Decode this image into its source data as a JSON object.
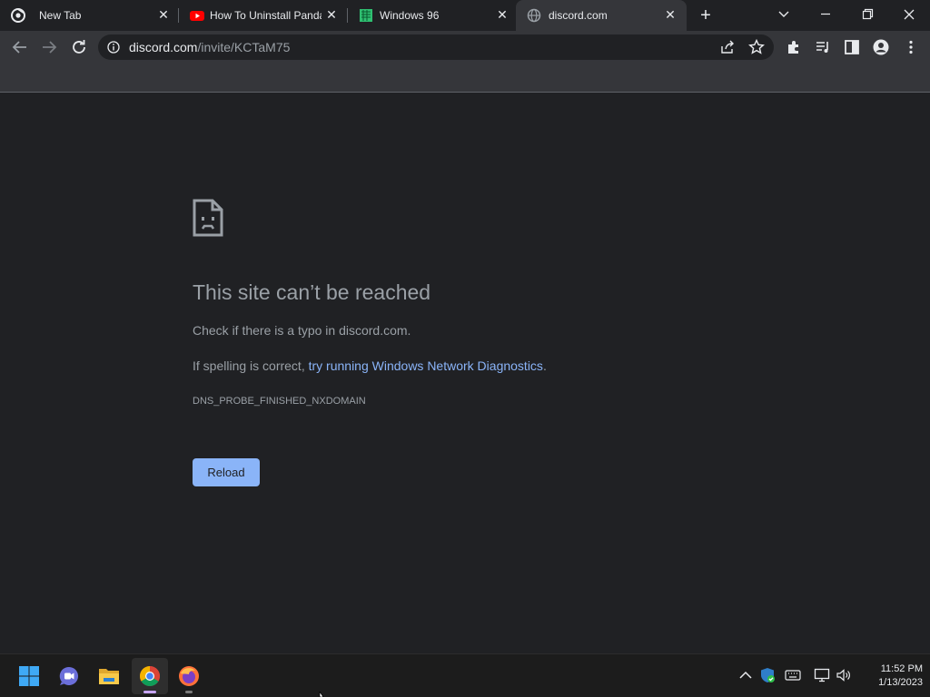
{
  "tabs": [
    {
      "title": "New Tab",
      "icon": "chrome-icon"
    },
    {
      "title": "How To Uninstall Panda",
      "icon": "youtube-icon"
    },
    {
      "title": "Windows 96",
      "icon": "windows96-icon"
    },
    {
      "title": "discord.com",
      "icon": "globe-icon",
      "active": true
    }
  ],
  "address_bar": {
    "host": "discord.com",
    "path": "/invite/KCTaM75"
  },
  "error": {
    "title": "This site can’t be reached",
    "line1": "Check if there is a typo in discord.com.",
    "line2_prefix": "If spelling is correct, ",
    "line2_link": "try running Windows Network Diagnostics",
    "line2_suffix": ".",
    "code": "DNS_PROBE_FINISHED_NXDOMAIN",
    "reload_label": "Reload"
  },
  "taskbar": {
    "apps": [
      "start-icon",
      "teams-chat-icon",
      "file-explorer-icon",
      "chrome-icon",
      "firefox-icon"
    ],
    "active_app": "chrome-icon",
    "time": "11:52 PM",
    "date": "1/13/2023"
  },
  "colors": {
    "background": "#202124",
    "toolbar": "#35363a",
    "link": "#8ab4f8",
    "text_secondary": "#9aa0a6"
  }
}
